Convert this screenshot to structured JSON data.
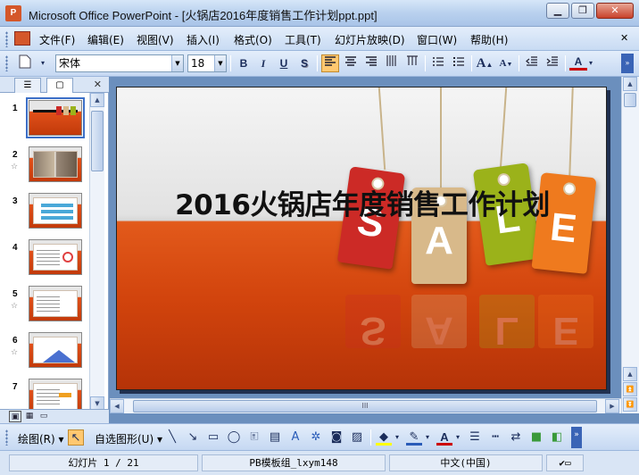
{
  "window": {
    "app_icon": "P",
    "title": "Microsoft Office PowerPoint - [火锅店2016年度销售工作计划ppt.ppt]",
    "minimize": "▁",
    "restore": "❐",
    "close": "✕"
  },
  "menu": {
    "items": [
      "文件(F)",
      "编辑(E)",
      "视图(V)",
      "插入(I)",
      "格式(O)",
      "工具(T)",
      "幻灯片放映(D)",
      "窗口(W)",
      "帮助(H)"
    ],
    "doc_close": "✕"
  },
  "format_toolbar": {
    "font_name": "宋体",
    "font_size": "18",
    "bold": "B",
    "italic": "I",
    "underline": "U",
    "shadow": "S",
    "grow_font": "A",
    "shrink_font": "A",
    "font_color": "A"
  },
  "panel": {
    "tab_outline": "☰",
    "tab_slides": "▢",
    "close": "✕",
    "thumbnails": [
      {
        "num": "1",
        "star": ""
      },
      {
        "num": "2",
        "star": "☆"
      },
      {
        "num": "3",
        "star": ""
      },
      {
        "num": "4",
        "star": ""
      },
      {
        "num": "5",
        "star": "☆"
      },
      {
        "num": "6",
        "star": "☆"
      },
      {
        "num": "7",
        "star": ""
      }
    ]
  },
  "slide": {
    "title": "2016火锅店年度销售工作计划",
    "tags": [
      {
        "letter": "S",
        "color": "#cc2a26"
      },
      {
        "letter": "A",
        "color": "#d8b98a"
      },
      {
        "letter": "L",
        "color": "#9bb21a"
      },
      {
        "letter": "E",
        "color": "#ef7a1e"
      }
    ]
  },
  "scroll": {
    "hthumb_grip": "III"
  },
  "draw_toolbar": {
    "draw_menu": "绘图(R)",
    "autoshapes_menu": "自选图形(U)"
  },
  "status": {
    "slide_pos": "幻灯片 1 / 21",
    "design": "PB模板组_lxym148",
    "language": "中文(中国)"
  }
}
